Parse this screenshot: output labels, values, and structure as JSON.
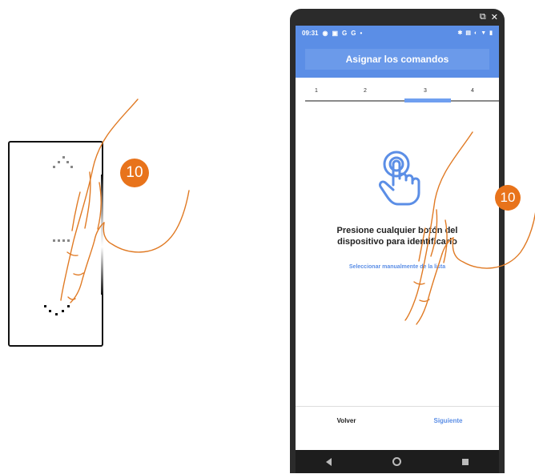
{
  "left_illustration": {
    "step_number": "10"
  },
  "phone": {
    "window_controls": [
      "⧉",
      "✕"
    ],
    "status_bar": {
      "time": "09:31",
      "left_icons": [
        "eye-icon",
        "message-icon",
        "G",
        "G",
        "•"
      ],
      "right_icons": [
        "bluetooth-icon",
        "nfc-icon",
        "sync-icon",
        "wifi-icon",
        "battery-icon"
      ]
    },
    "app_bar": {
      "title": "Asignar los comandos"
    },
    "stepper": {
      "steps": [
        "1",
        "2",
        "3",
        "4"
      ],
      "active_step": 3
    },
    "instruction_line1": "Presione cualquier botón del",
    "instruction_line2": "dispositivo para identificarlo",
    "manual_link": "Seleccionar manualmente de la lista",
    "back_button": "Volver",
    "next_button": "Siguiente",
    "step_number": "10"
  },
  "colors": {
    "accent_blue": "#5b8ee6",
    "step_badge_orange": "#e8731b",
    "hand_outline": "#e07a24"
  }
}
